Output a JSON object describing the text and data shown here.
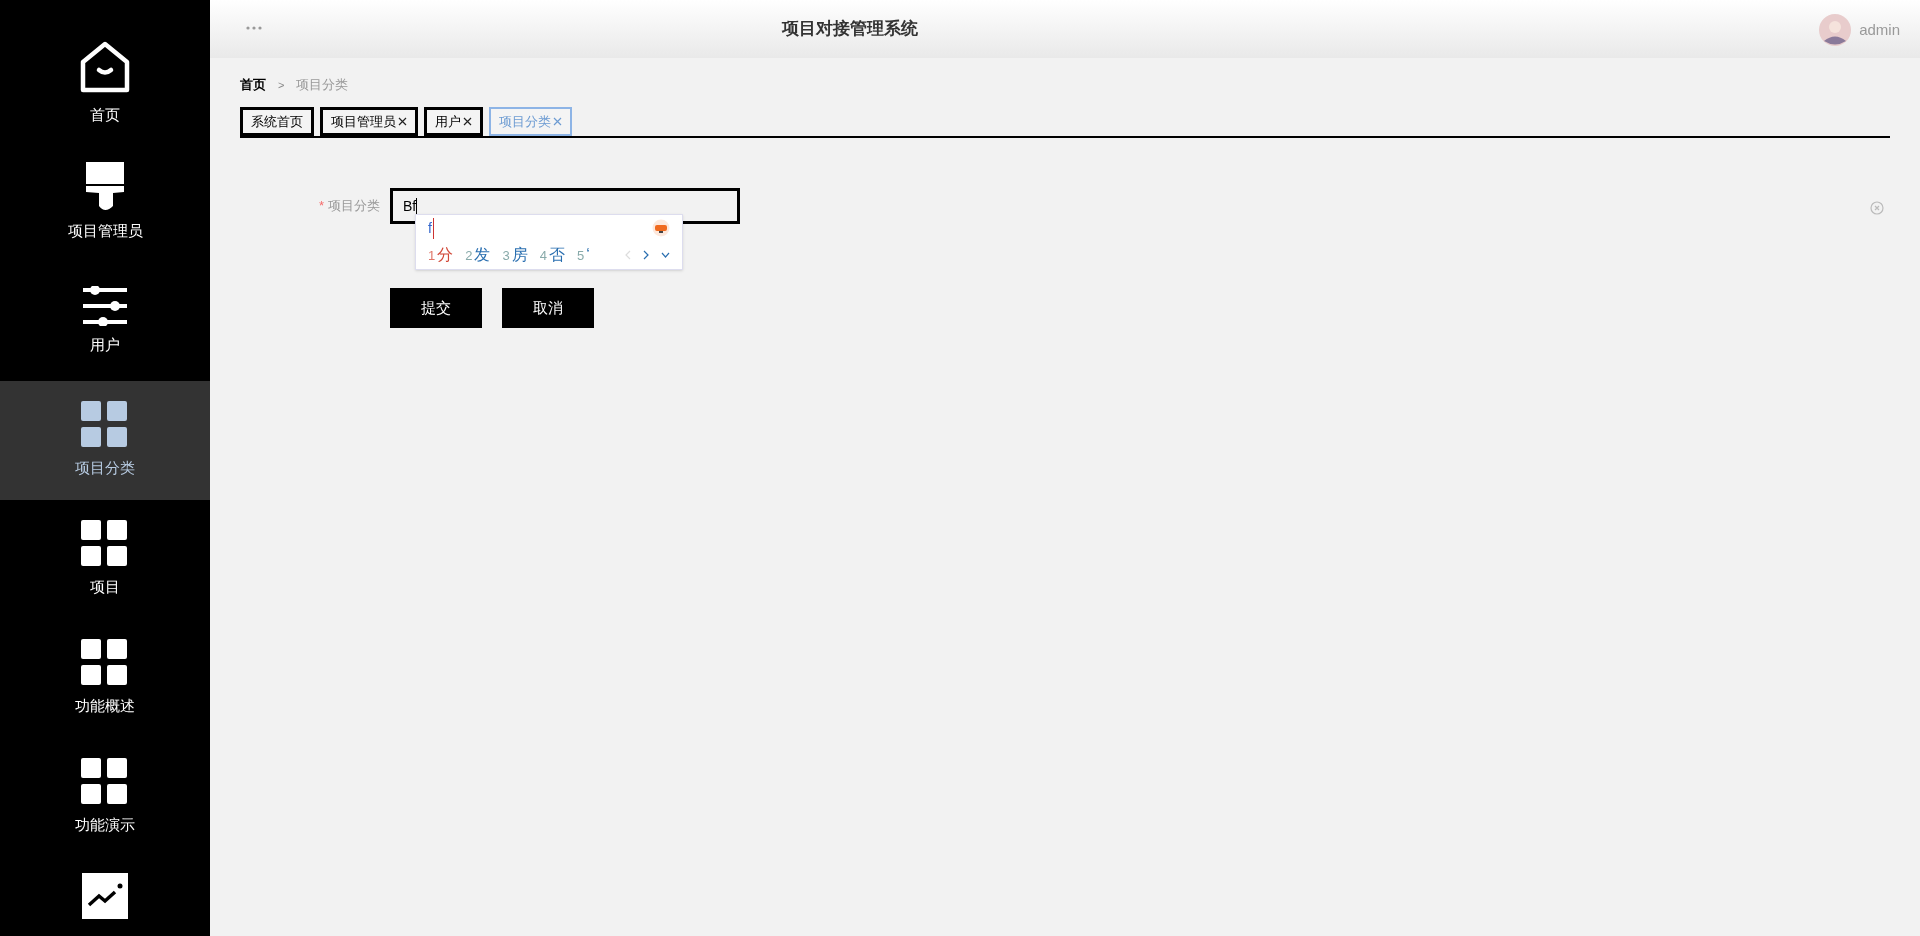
{
  "sidebar": {
    "items": [
      {
        "label": "首页",
        "kind": "home",
        "selected": false
      },
      {
        "label": "项目管理员",
        "kind": "brush",
        "selected": false
      },
      {
        "label": "用户",
        "kind": "sliders",
        "selected": false
      },
      {
        "label": "项目分类",
        "kind": "grid",
        "selected": true
      },
      {
        "label": "项目",
        "kind": "grid",
        "selected": false
      },
      {
        "label": "功能概述",
        "kind": "grid",
        "selected": false
      },
      {
        "label": "功能演示",
        "kind": "grid",
        "selected": false
      },
      {
        "kind": "chart",
        "selected": false
      }
    ]
  },
  "header": {
    "title": "项目对接管理系统",
    "user": "admin"
  },
  "breadcrumb": {
    "items": [
      "首页",
      "项目分类"
    ],
    "separator": ">"
  },
  "tabs": [
    {
      "label": "系统首页",
      "closable": false,
      "selected": false
    },
    {
      "label": "项目管理员",
      "closable": true,
      "selected": false
    },
    {
      "label": "用户",
      "closable": true,
      "selected": false
    },
    {
      "label": "项目分类",
      "closable": true,
      "selected": true
    }
  ],
  "form": {
    "field": {
      "label": "项目分类",
      "required_mark": "*",
      "value": "Bf"
    },
    "buttons": [
      "提交",
      "取消"
    ]
  },
  "ime": {
    "composition": "f",
    "candidates": [
      {
        "number": "1",
        "text": "分",
        "selected": true
      },
      {
        "number": "2",
        "text": "发",
        "selected": false
      },
      {
        "number": "3",
        "text": "房",
        "selected": false
      },
      {
        "number": "4",
        "text": "否",
        "selected": false
      },
      {
        "number": "5",
        "text": "‘",
        "selected": false
      }
    ]
  }
}
